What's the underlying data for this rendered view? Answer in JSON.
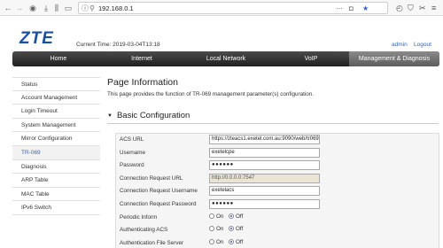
{
  "browser": {
    "url": "192.168.0.1"
  },
  "header": {
    "logo": "ZTE",
    "current_time": "Current Time: 2019-03-04T13:18",
    "user": "admin",
    "logout": "Logout"
  },
  "topnav": [
    {
      "label": "Home",
      "active": false
    },
    {
      "label": "Internet",
      "active": false
    },
    {
      "label": "Local Network",
      "active": false
    },
    {
      "label": "VoIP",
      "active": false
    },
    {
      "label": "Management & Diagnosis",
      "active": true
    }
  ],
  "sidebar": [
    {
      "label": "Status",
      "active": false
    },
    {
      "label": "Account Management",
      "active": false
    },
    {
      "label": "Login Timeout",
      "active": false
    },
    {
      "label": "System Management",
      "active": false
    },
    {
      "label": "Mirror Configuration",
      "active": false
    },
    {
      "label": "TR-069",
      "active": true
    },
    {
      "label": "Diagnosis",
      "active": false
    },
    {
      "label": "ARP Table",
      "active": false
    },
    {
      "label": "MAC Table",
      "active": false
    },
    {
      "label": "IPv6 Switch",
      "active": false
    }
  ],
  "content": {
    "title": "Page Information",
    "description": "This page provides the function of TR-069 management parameter(s) configuration.",
    "section_title": "Basic Configuration"
  },
  "form": {
    "acs_url": {
      "label": "ACS URL",
      "value": "https://zteacs1.exetel.com.au:9090/web/tr069"
    },
    "username": {
      "label": "Username",
      "value": "exetelcpe"
    },
    "password": {
      "label": "Password",
      "value": "●●●●●●"
    },
    "conn_req_url": {
      "label": "Connection Request URL",
      "value": "http://0.0.0.0:7547"
    },
    "conn_req_username": {
      "label": "Connection Request Username",
      "value": "exetelacs"
    },
    "conn_req_password": {
      "label": "Connection Request Password",
      "value": "●●●●●●"
    },
    "periodic_inform": {
      "label": "Periodic Inform",
      "on": "On",
      "off": "Off",
      "selected": "Off"
    },
    "auth_acs": {
      "label": "Authenticating ACS",
      "on": "On",
      "off": "Off",
      "selected": "Off"
    },
    "auth_file_server": {
      "label": "Authentication File Server",
      "on": "On",
      "off": "Off",
      "selected": "Off"
    }
  }
}
